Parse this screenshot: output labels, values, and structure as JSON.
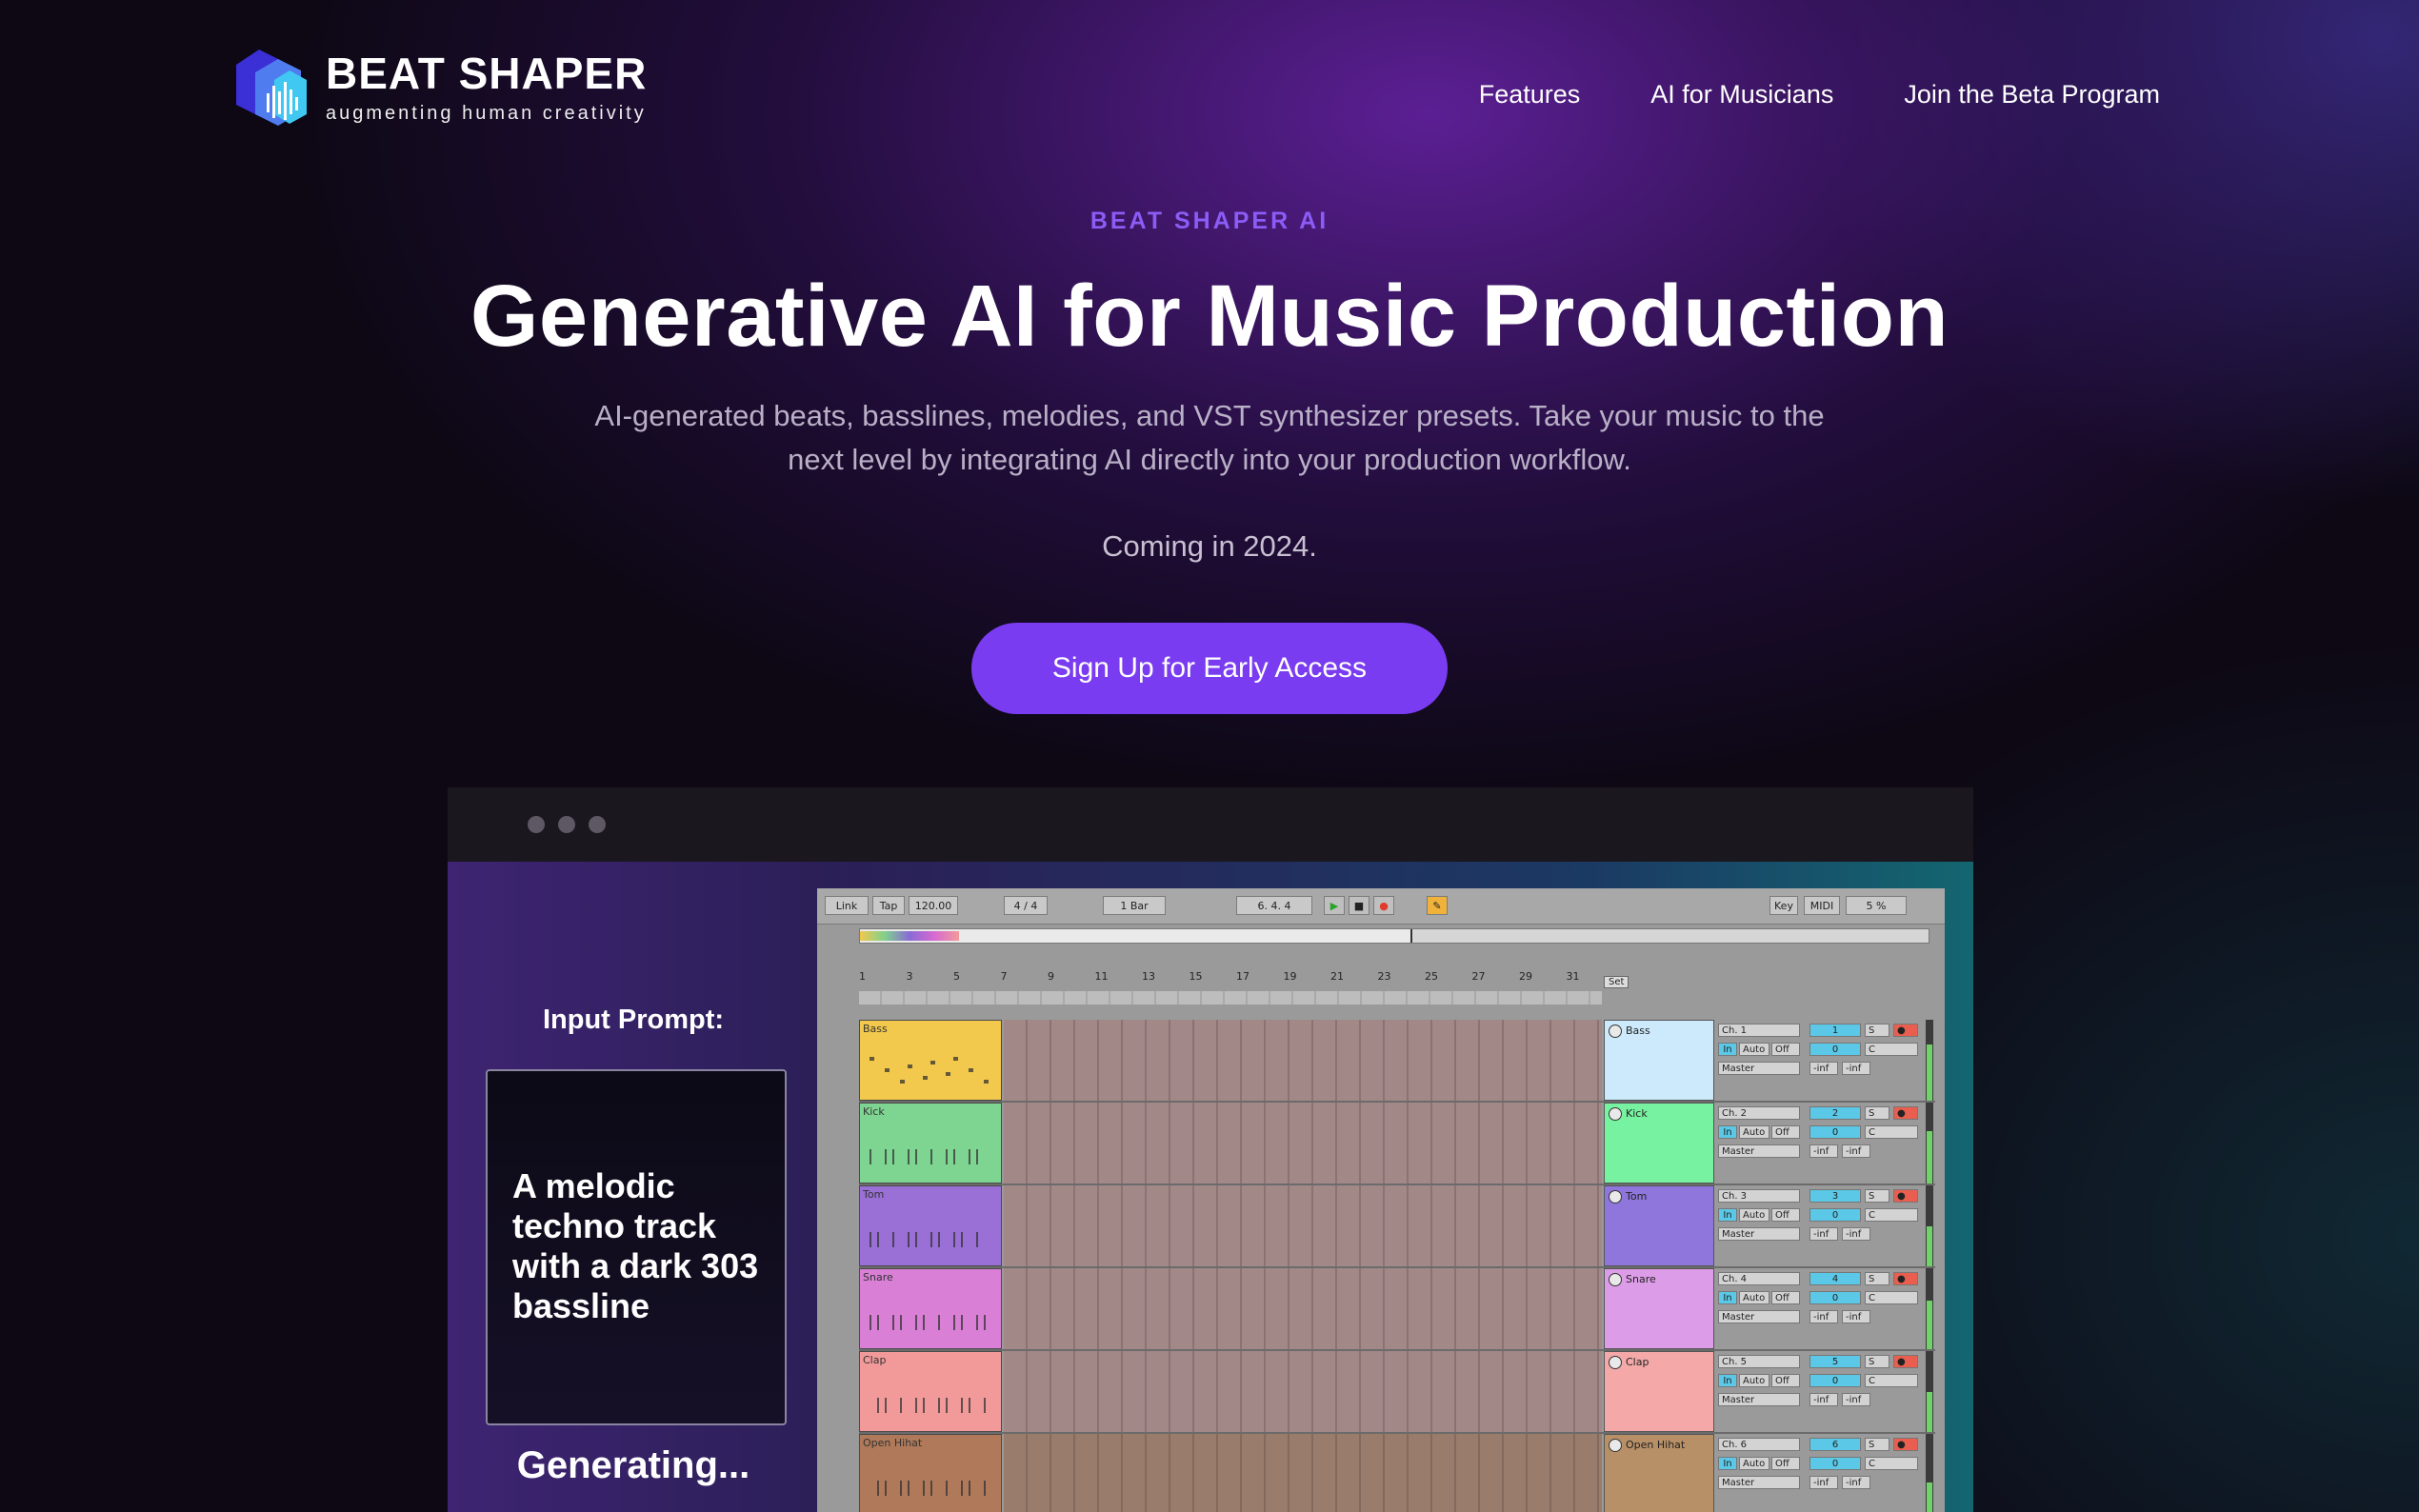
{
  "brand": {
    "name": "BEAT SHAPER",
    "tagline": "augmenting human creativity"
  },
  "nav": {
    "items": [
      "Features",
      "AI for Musicians",
      "Join the Beta Program"
    ]
  },
  "hero": {
    "eyebrow": "BEAT SHAPER AI",
    "title": "Generative AI for Music Production",
    "subtitle": "AI-generated beats, basslines, melodies, and VST synthesizer presets. Take your music to the next level by integrating AI directly into your production workflow.",
    "coming": "Coming in 2024.",
    "cta_label": "Sign Up for Early Access"
  },
  "demo": {
    "prompt_label": "Input Prompt:",
    "prompt_text": "A melodic techno track with a dark 303 bassline",
    "status": "Generating...",
    "toolbar": {
      "link": "Link",
      "tap": "Tap",
      "tempo": "120.00",
      "signature": "4 / 4",
      "quantize": "1 Bar",
      "position": "6.   4.   4",
      "key": "Key",
      "midi": "MIDI",
      "cpu": "5 %"
    },
    "set_label": "Set",
    "ruler": [
      "1",
      "3",
      "5",
      "7",
      "9",
      "11",
      "13",
      "15",
      "17",
      "19",
      "21",
      "23",
      "25",
      "27",
      "29",
      "31"
    ],
    "tracks": [
      {
        "name": "Bass",
        "color": "#f2c94c",
        "device_color": "#cdeafc",
        "channel": "Ch. 1",
        "number": "1"
      },
      {
        "name": "Kick",
        "color": "#7ed591",
        "device_color": "#77f2a0",
        "channel": "Ch. 2",
        "number": "2"
      },
      {
        "name": "Tom",
        "color": "#9a6fd6",
        "device_color": "#8f76dc",
        "channel": "Ch. 3",
        "number": "3"
      },
      {
        "name": "Snare",
        "color": "#d97fd6",
        "device_color": "#dd9ce7",
        "channel": "Ch. 4",
        "number": "4"
      },
      {
        "name": "Clap",
        "color": "#f29a9a",
        "device_color": "#f4a8a8",
        "channel": "Ch. 5",
        "number": "5"
      },
      {
        "name": "Open Hihat",
        "color": "#b07a5a",
        "device_color": "#b89067",
        "channel": "Ch. 6",
        "number": "6"
      }
    ],
    "mixer_labels": {
      "in": "In",
      "auto": "Auto",
      "off": "Off",
      "master": "Master",
      "zero": "0",
      "center": "C",
      "inf": "-inf",
      "solo": "S"
    }
  },
  "colors": {
    "accent": "#7a3cf0",
    "eyebrow": "#8b5cf6",
    "background": "#0d0814"
  }
}
